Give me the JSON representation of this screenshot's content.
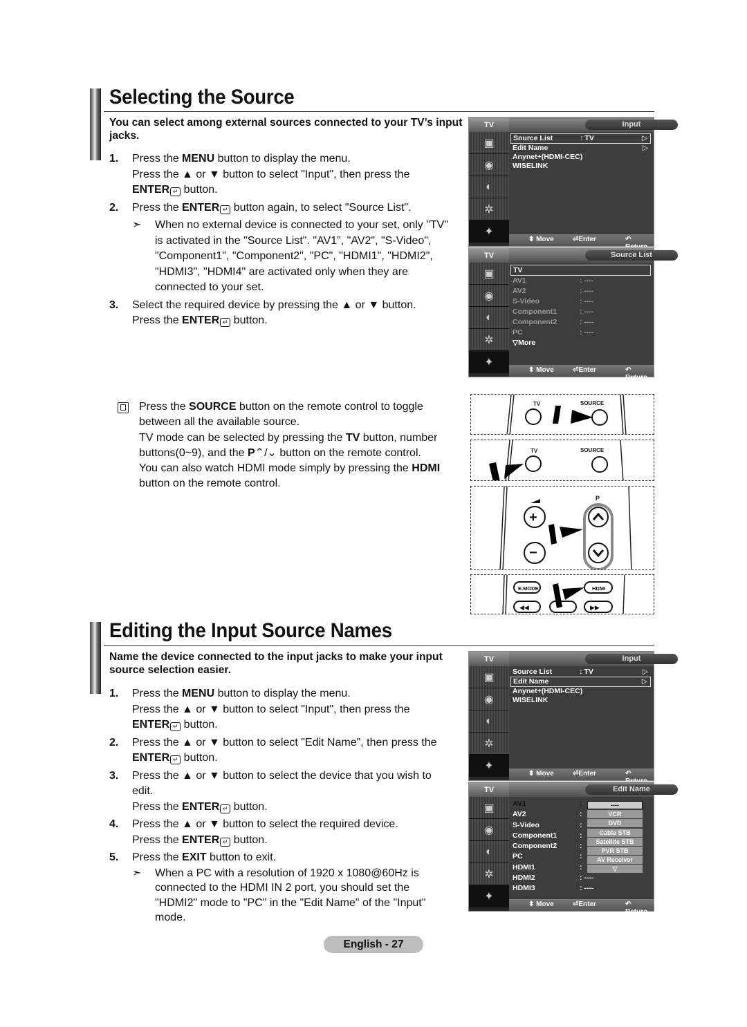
{
  "section1": {
    "title": "Selecting the Source",
    "intro": "You can select among external sources connected to your TV’s input jacks.",
    "steps": [
      {
        "num": "1.",
        "lines": [
          "Press the ",
          "MENU",
          " button to display the menu."
        ],
        "line2": "Press the ▲ or ▼ button to select \"Input\", then press the",
        "line3_bold": "ENTER",
        "line3_rest": " button."
      },
      {
        "num": "2.",
        "pre": "Press the ",
        "bold": "ENTER",
        "post": " button again, to select \"Source List\"."
      },
      {
        "num": "3.",
        "line1": "Select the required device by pressing the ▲ or ▼ button.",
        "pre": "Press the ",
        "bold": "ENTER",
        "post": " button."
      }
    ],
    "note_arrow": "➣",
    "note": "When no external device is connected to your set, only \"TV\" is activated in the \"Source List\". \"AV1\", \"AV2\", \"S-Video\", \"Component1\", \"Component2\", \"PC\", \"HDMI1\", \"HDMI2\", \"HDMI3\", \"HDMI4\" are activated only when they are connected to your set.",
    "tip": {
      "p1_pre": "Press the ",
      "p1_bold": "SOURCE",
      "p1_post": " button on the remote control to toggle between all the available source.",
      "p2_pre": "TV mode can be selected by pressing the ",
      "p2_bold": "TV",
      "p2_mid": " button, number buttons(0~9), and the ",
      "p2_bold2": "P",
      "p2_glyph": "⌃/⌄",
      "p2_post": " button on the remote control.",
      "p3_pre": "You can also watch HDMI mode simply by pressing the ",
      "p3_bold": "HDMI",
      "p3_post": " button on the remote control."
    }
  },
  "section2": {
    "title": "Editing the Input Source Names",
    "intro": "Name the device connected to the input jacks to make your input source selection easier.",
    "step1": {
      "num": "1.",
      "pre": "Press the ",
      "bold": "MENU",
      "post": " button to display the menu.",
      "line2": "Press the ▲ or ▼ button to select \"Input\", then press the",
      "line3_bold": "ENTER",
      "line3_rest": " button."
    },
    "step2": {
      "num": "2.",
      "line1": "Press the ▲ or ▼ button to select \"Edit Name\", then press the",
      "bold": "ENTER",
      "post": " button."
    },
    "step3": {
      "num": "3.",
      "line1": "Press the ▲ or ▼ button to select the device that you wish to edit.",
      "pre": "Press the ",
      "bold": "ENTER",
      "post": " button."
    },
    "step4": {
      "num": "4.",
      "line1": "Press the ▲ or ▼ button to select the required device.",
      "pre": "Press the ",
      "bold": "ENTER",
      "post": " button."
    },
    "step5": {
      "num": "5.",
      "pre": "Press the ",
      "bold": "EXIT",
      "post": " button to exit."
    },
    "note_arrow": "➣",
    "note": "When a PC with a resolution of 1920 x 1080@60Hz is connected to the HDMI IN 2 port, you should set the \"HDMI2\" mode to \"PC\" in the \"Edit Name\" of the \"Input\" mode."
  },
  "osd_common": {
    "tv": "TV",
    "move": "⬍ Move",
    "enter": "⏎Enter",
    "return": "↶ Return",
    "tri": "▷"
  },
  "osd1": {
    "title": "Input",
    "items": [
      {
        "label": "Source List",
        "value": ": TV",
        "arrow": "▷"
      },
      {
        "label": "Edit Name",
        "value": "",
        "arrow": "▷"
      },
      {
        "label": "Anynet+(HDMI-CEC)",
        "value": "",
        "arrow": ""
      },
      {
        "label": "WISELINK",
        "value": "",
        "arrow": ""
      }
    ]
  },
  "osd2": {
    "title": "Source List",
    "items": [
      {
        "label": "TV",
        "value": ""
      },
      {
        "label": "AV1",
        "value": ": ----"
      },
      {
        "label": "AV2",
        "value": ": ----"
      },
      {
        "label": "S-Video",
        "value": ": ----"
      },
      {
        "label": "Component1",
        "value": ": ----"
      },
      {
        "label": "Component2",
        "value": ": ----"
      },
      {
        "label": "PC",
        "value": ": ----"
      },
      {
        "label": "▽More",
        "value": ""
      }
    ]
  },
  "osd3": {
    "title": "Input",
    "items": [
      {
        "label": "Source List",
        "value": ": TV",
        "arrow": "▷"
      },
      {
        "label": "Edit Name",
        "value": "",
        "arrow": "▷"
      },
      {
        "label": "Anynet+(HDMI-CEC)",
        "value": "",
        "arrow": ""
      },
      {
        "label": "WISELINK",
        "value": "",
        "arrow": ""
      }
    ]
  },
  "osd4": {
    "title": "Edit Name",
    "items": [
      {
        "label": "AV1",
        "value": ":"
      },
      {
        "label": "AV2",
        "value": ":"
      },
      {
        "label": "S-Video",
        "value": ":"
      },
      {
        "label": "Component1",
        "value": ":"
      },
      {
        "label": "Component2",
        "value": ":"
      },
      {
        "label": "PC",
        "value": ":"
      },
      {
        "label": "HDMI1",
        "value": ":"
      },
      {
        "label": "HDMI2",
        "value": ": ----"
      },
      {
        "label": "HDMI3",
        "value": ": ----"
      }
    ],
    "options": [
      "----",
      "VCR",
      "DVD",
      "Cable STB",
      "Satellite STB",
      "PVR STB",
      "AV Receiver",
      "▽"
    ]
  },
  "remote": {
    "tv": "TV",
    "source": "SOURCE",
    "p": "P",
    "emode": "E.MODE",
    "hdmi": "HDMI"
  },
  "footer": {
    "page": "English - 27"
  }
}
